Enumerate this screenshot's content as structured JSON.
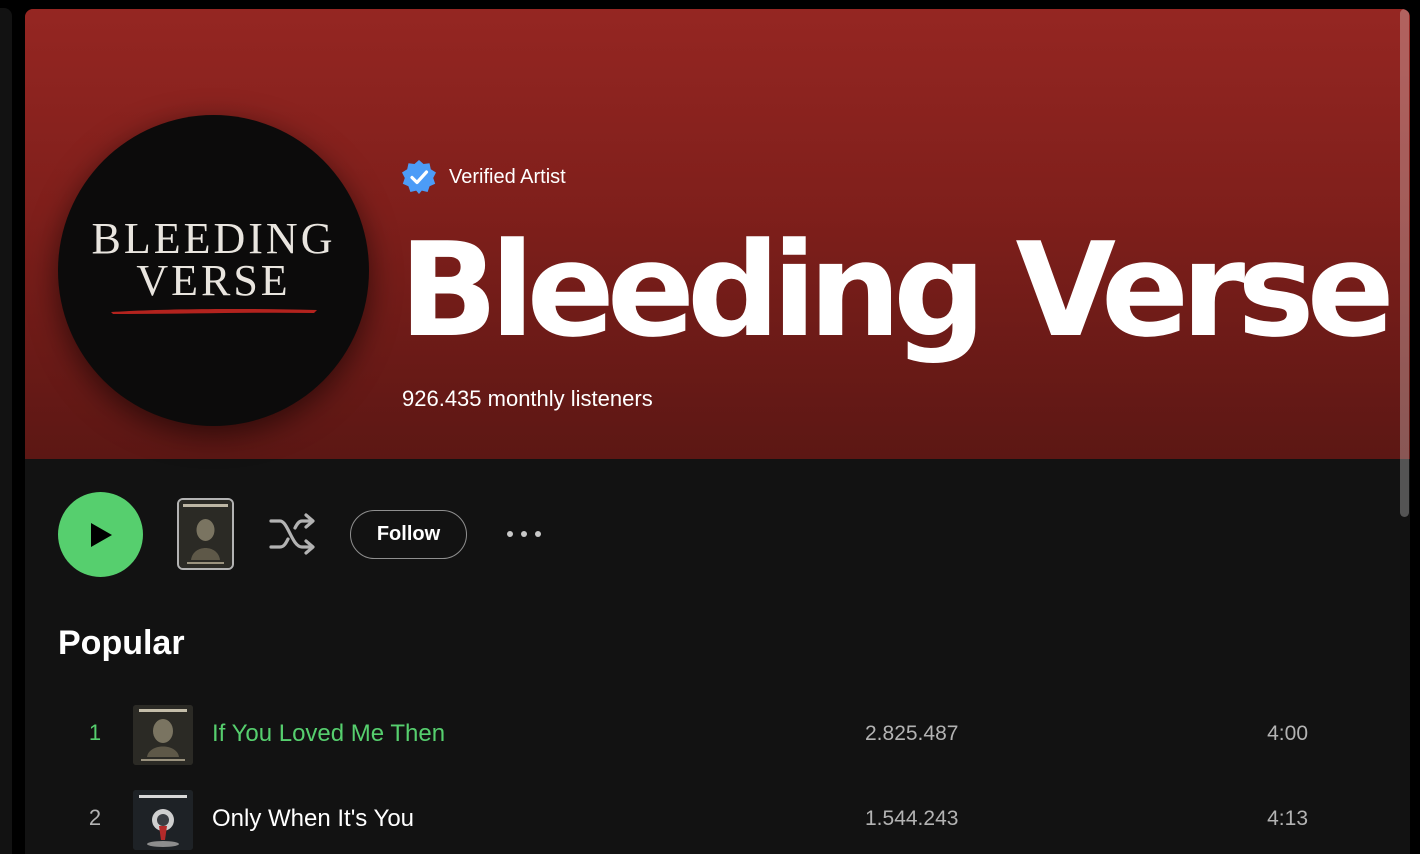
{
  "artist": {
    "verified_label": "Verified Artist",
    "name": "Bleeding Verse",
    "monthly_listeners": "926.435 monthly listeners",
    "logo_line1": "BLEEDING",
    "logo_line2": "VERSE"
  },
  "controls": {
    "follow_label": "Follow"
  },
  "popular": {
    "title": "Popular",
    "tracks": [
      {
        "number": "1",
        "title": "If You Loved Me Then",
        "plays": "2.825.487",
        "duration": "4:00",
        "playing": true
      },
      {
        "number": "2",
        "title": "Only When It's You",
        "plays": "1.544.243",
        "duration": "4:13",
        "playing": false
      }
    ]
  },
  "colors": {
    "accent_green": "#56cf6e",
    "header_red": "#952622",
    "verified_blue": "#4c9cf7"
  },
  "icons": [
    "verified-badge-icon",
    "play-icon",
    "shuffle-icon",
    "more-options-icon"
  ]
}
